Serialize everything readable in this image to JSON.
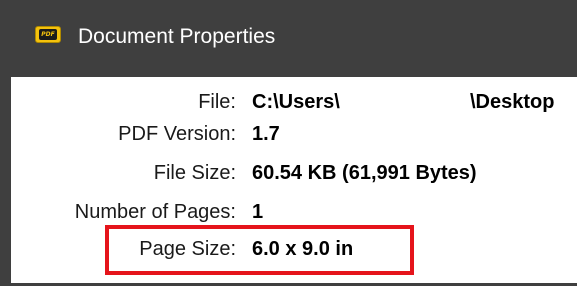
{
  "window": {
    "title": "Document Properties",
    "icon_label": "PDF",
    "icon": "pdf-app-icon"
  },
  "properties": {
    "file_label": "File:",
    "file_value_part1": "C:\\Users\\",
    "file_value_part2": "\\Desktop",
    "pdf_version_label": "PDF Version:",
    "pdf_version_value": "1.7",
    "file_size_label": "File Size:",
    "file_size_value": "60.54 KB (61,991 Bytes)",
    "num_pages_label": "Number of Pages:",
    "num_pages_value": "1",
    "page_size_label": "Page Size:",
    "page_size_value": "6.0 x 9.0 in"
  },
  "colors": {
    "titlebar": "#3f3f3f",
    "highlight": "#e5141b",
    "icon_accent": "#f4c20d"
  }
}
